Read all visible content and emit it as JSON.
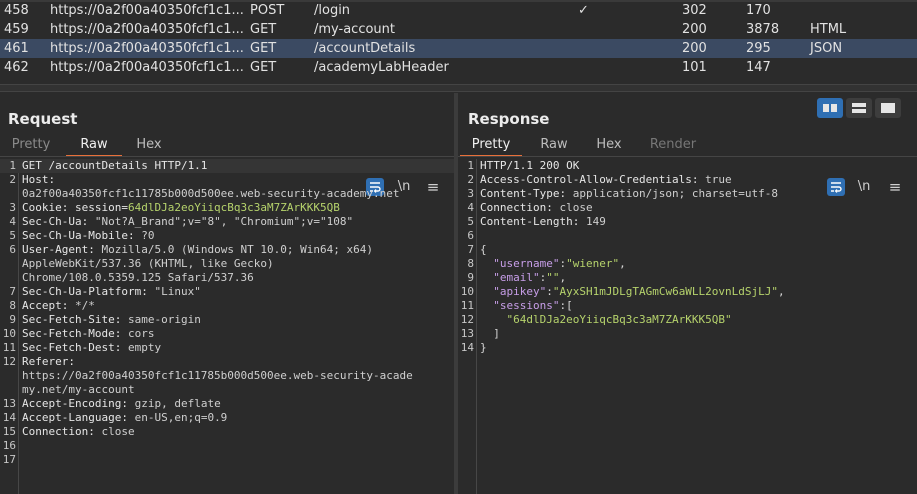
{
  "history": {
    "rows": [
      {
        "num": "458",
        "host": "https://0a2f00a40350fcf1c1...",
        "method": "POST",
        "url": "/login",
        "edited": "✓",
        "status": "302",
        "length": "170",
        "mime": ""
      },
      {
        "num": "459",
        "host": "https://0a2f00a40350fcf1c1...",
        "method": "GET",
        "url": "/my-account",
        "edited": "",
        "status": "200",
        "length": "3878",
        "mime": "HTML"
      },
      {
        "num": "461",
        "host": "https://0a2f00a40350fcf1c1...",
        "method": "GET",
        "url": "/accountDetails",
        "edited": "",
        "status": "200",
        "length": "295",
        "mime": "JSON",
        "selected": true
      },
      {
        "num": "462",
        "host": "https://0a2f00a40350fcf1c1...",
        "method": "GET",
        "url": "/academyLabHeader",
        "edited": "",
        "status": "101",
        "length": "147",
        "mime": ""
      }
    ]
  },
  "request": {
    "title": "Request",
    "tabs": [
      "Pretty",
      "Raw",
      "Hex"
    ],
    "active_tab": "Raw",
    "newline_label": "\\n",
    "menu_glyph": "≡"
  },
  "response": {
    "title": "Response",
    "tabs": [
      "Pretty",
      "Raw",
      "Hex",
      "Render"
    ],
    "active_tab": "Pretty",
    "newline_label": "\\n",
    "menu_glyph": "≡"
  },
  "colors": {
    "accent": "#e8703a",
    "selected_row": "#3b4a62",
    "button_blue": "#2f6fb3",
    "json_string": "#b6d36c",
    "json_key": "#c79ee8"
  },
  "request_lines": [
    {
      "n": "1",
      "segs": [
        {
          "t": "GET /accountDetails HTTP/1.1",
          "c": "k"
        }
      ]
    },
    {
      "n": "2",
      "segs": [
        {
          "t": "Host:",
          "c": "k"
        }
      ]
    },
    {
      "n": "",
      "segs": [
        {
          "t": "0a2f00a40350fcf1c11785b000d500ee.web-security-academy.net",
          "c": "v"
        }
      ]
    },
    {
      "n": "3",
      "segs": [
        {
          "t": "Cookie: session=",
          "c": "k"
        },
        {
          "t": "64dlDJa2eoYiiqcBq3c3aM7ZArKKK5QB",
          "c": "g"
        }
      ]
    },
    {
      "n": "4",
      "segs": [
        {
          "t": "Sec-Ch-Ua: ",
          "c": "k"
        },
        {
          "t": "\"Not?A_Brand\";v=\"8\", \"Chromium\";v=\"108\"",
          "c": "v"
        }
      ]
    },
    {
      "n": "5",
      "segs": [
        {
          "t": "Sec-Ch-Ua-Mobile: ",
          "c": "k"
        },
        {
          "t": "?0",
          "c": "v"
        }
      ]
    },
    {
      "n": "6",
      "segs": [
        {
          "t": "User-Agent: ",
          "c": "k"
        },
        {
          "t": "Mozilla/5.0 (Windows NT 10.0; Win64; x64)",
          "c": "v"
        }
      ]
    },
    {
      "n": "",
      "segs": [
        {
          "t": "AppleWebKit/537.36 (KHTML, like Gecko)",
          "c": "v"
        }
      ]
    },
    {
      "n": "",
      "segs": [
        {
          "t": "Chrome/108.0.5359.125 Safari/537.36",
          "c": "v"
        }
      ]
    },
    {
      "n": "7",
      "segs": [
        {
          "t": "Sec-Ch-Ua-Platform: ",
          "c": "k"
        },
        {
          "t": "\"Linux\"",
          "c": "v"
        }
      ]
    },
    {
      "n": "8",
      "segs": [
        {
          "t": "Accept: ",
          "c": "k"
        },
        {
          "t": "*/*",
          "c": "v"
        }
      ]
    },
    {
      "n": "9",
      "segs": [
        {
          "t": "Sec-Fetch-Site: ",
          "c": "k"
        },
        {
          "t": "same-origin",
          "c": "v"
        }
      ]
    },
    {
      "n": "10",
      "segs": [
        {
          "t": "Sec-Fetch-Mode: ",
          "c": "k"
        },
        {
          "t": "cors",
          "c": "v"
        }
      ]
    },
    {
      "n": "11",
      "segs": [
        {
          "t": "Sec-Fetch-Dest: ",
          "c": "k"
        },
        {
          "t": "empty",
          "c": "v"
        }
      ]
    },
    {
      "n": "12",
      "segs": [
        {
          "t": "Referer:",
          "c": "k"
        }
      ]
    },
    {
      "n": "",
      "segs": [
        {
          "t": "https://0a2f00a40350fcf1c11785b000d500ee.web-security-acade",
          "c": "v"
        }
      ]
    },
    {
      "n": "",
      "segs": [
        {
          "t": "my.net/my-account",
          "c": "v"
        }
      ]
    },
    {
      "n": "13",
      "segs": [
        {
          "t": "Accept-Encoding: ",
          "c": "k"
        },
        {
          "t": "gzip, deflate",
          "c": "v"
        }
      ]
    },
    {
      "n": "14",
      "segs": [
        {
          "t": "Accept-Language: ",
          "c": "k"
        },
        {
          "t": "en-US,en;q=0.9",
          "c": "v"
        }
      ]
    },
    {
      "n": "15",
      "segs": [
        {
          "t": "Connection: ",
          "c": "k"
        },
        {
          "t": "close",
          "c": "v"
        }
      ]
    },
    {
      "n": "16",
      "segs": []
    },
    {
      "n": "17",
      "segs": []
    }
  ],
  "response_lines": [
    {
      "n": "1",
      "segs": [
        {
          "t": "HTTP/1.1 200 OK",
          "c": "k"
        }
      ]
    },
    {
      "n": "2",
      "segs": [
        {
          "t": "Access-Control-Allow-Credentials: ",
          "c": "k"
        },
        {
          "t": "true",
          "c": "v"
        }
      ]
    },
    {
      "n": "3",
      "segs": [
        {
          "t": "Content-Type: ",
          "c": "k"
        },
        {
          "t": "application/json; charset=utf-8",
          "c": "v"
        }
      ]
    },
    {
      "n": "4",
      "segs": [
        {
          "t": "Connection: ",
          "c": "k"
        },
        {
          "t": "close",
          "c": "v"
        }
      ]
    },
    {
      "n": "5",
      "segs": [
        {
          "t": "Content-Length: ",
          "c": "k"
        },
        {
          "t": "149",
          "c": "v"
        }
      ]
    },
    {
      "n": "6",
      "segs": []
    },
    {
      "n": "7",
      "segs": [
        {
          "t": "{",
          "c": "pl"
        }
      ]
    },
    {
      "n": "8",
      "segs": [
        {
          "t": "  \"username\"",
          "c": "p"
        },
        {
          "t": ":",
          "c": "pl"
        },
        {
          "t": "\"wiener\"",
          "c": "g"
        },
        {
          "t": ",",
          "c": "pl"
        }
      ]
    },
    {
      "n": "9",
      "segs": [
        {
          "t": "  \"email\"",
          "c": "p"
        },
        {
          "t": ":",
          "c": "pl"
        },
        {
          "t": "\"\"",
          "c": "g"
        },
        {
          "t": ",",
          "c": "pl"
        }
      ]
    },
    {
      "n": "10",
      "segs": [
        {
          "t": "  \"apikey\"",
          "c": "p"
        },
        {
          "t": ":",
          "c": "pl"
        },
        {
          "t": "\"AyxSH1mJDLgTAGmCw6aWLL2ovnLdSjLJ\"",
          "c": "g"
        },
        {
          "t": ",",
          "c": "pl"
        }
      ]
    },
    {
      "n": "11",
      "segs": [
        {
          "t": "  \"sessions\"",
          "c": "p"
        },
        {
          "t": ":[",
          "c": "pl"
        }
      ]
    },
    {
      "n": "12",
      "segs": [
        {
          "t": "    \"64dlDJa2eoYiiqcBq3c3aM7ZArKKK5QB\"",
          "c": "g"
        }
      ]
    },
    {
      "n": "13",
      "segs": [
        {
          "t": "  ]",
          "c": "pl"
        }
      ]
    },
    {
      "n": "14",
      "segs": [
        {
          "t": "}",
          "c": "pl"
        }
      ]
    }
  ]
}
